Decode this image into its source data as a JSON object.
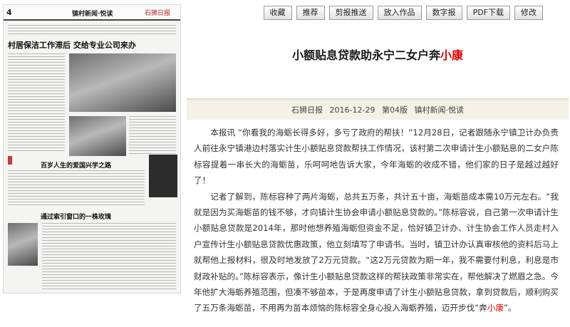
{
  "toolbar": {
    "buttons": [
      {
        "label": "收藏"
      },
      {
        "label": "推荐"
      },
      {
        "label": "剪报推送"
      },
      {
        "label": "放入作品"
      },
      {
        "label": "数字报"
      },
      {
        "label": "PDF下载"
      },
      {
        "label": "修改"
      }
    ]
  },
  "thumbnail": {
    "page_number": "4",
    "section": "镇村新闻·悦读",
    "masthead": "石狮日报",
    "headline_main": "村居保洁工作滞后 交给专业公司来办",
    "headline_mid": "百岁人生的爱国兴学之路",
    "headline_low": "通过索引窗口的一株玫瑰"
  },
  "article": {
    "title_prefix": "小额贴息贷款助永宁二女户奔",
    "title_highlight": "小康",
    "source": "石狮日报",
    "date": "2016-12-29",
    "page": "第04版",
    "section": "镇村新闻·悦读",
    "paragraph1": "本报讯 “你看我的海蛎长得多好，多亏了政府的帮扶！”12月28日，记者跟随永宁镇卫计办负责人前往永宁镇港边村落实计生小额贴息贷款帮扶工作情况，该村第二次申请计生小额贴息的二女户陈标容提着一串长大的海蛎苗，乐呵呵地告诉大家，今年海蛎的收成不错，他们家的日子是越过越好了！",
    "paragraph2_main": "记者了解到，陈标容种了两片海蛎，总共五万条，共计五十亩，海蛎苗成本需10万元左右。“我就是因为买海蛎苗的钱不够，才向镇计生协会申请小额贴息贷款的。”陈标容说，自己第一次申请计生小额贴息贷款是2014年，那时他想养殖海蛎但资金不足，恰好镇卫计办、计生协会工作人员走村入户宣传计生小额贴息贷款优惠政策，他立刻填写了申请书。当时，镇卫计办认真审核他的资料后马上就帮他上报材料，很及时地发放了2万元贷款。“这2万元贷款为期一年，我不需要付利息，利息是市财政补贴的。”陈标容表示，像计生小额贴息贷款这样的帮扶政策非常实在，帮他解决了燃眉之急。今年他扩大海蛎养殖范围，但凑不够苗本，于是再度申请了计生小额贴息贷款，拿到贷款后，顺利购买了五万条海蛎苗，不用再为苗本烦恼的陈标容全身心投入海蛎养殖，迈开步伐“奔",
    "paragraph2_highlight": "小康",
    "paragraph2_tail": "”。"
  }
}
